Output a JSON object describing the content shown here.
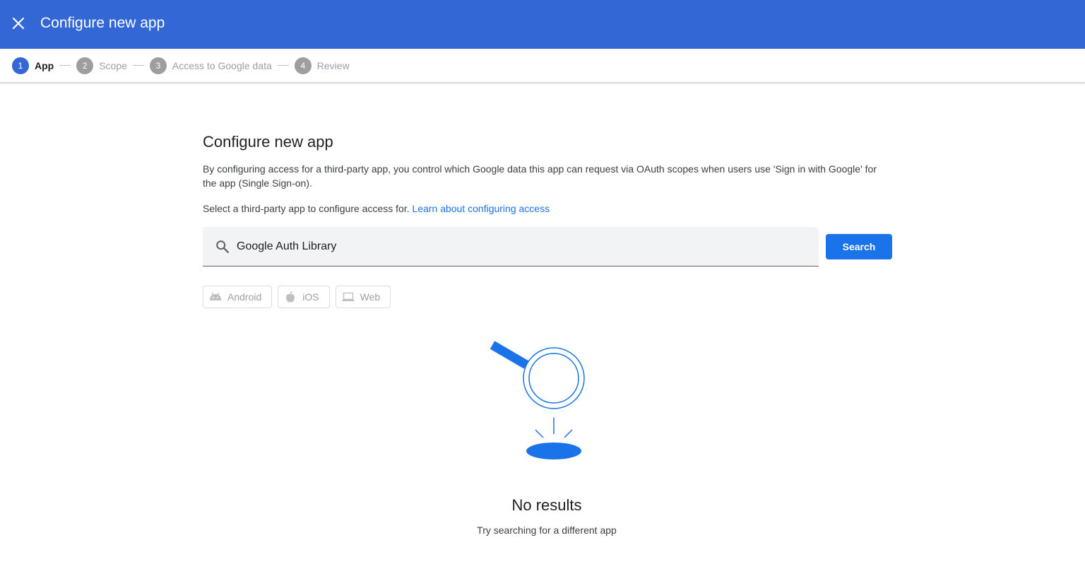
{
  "header": {
    "title": "Configure new app",
    "close_icon": "close-icon",
    "background_color": "#3367d6"
  },
  "stepper": {
    "steps": [
      {
        "number": "1",
        "label": "App",
        "active": true
      },
      {
        "number": "2",
        "label": "Scope",
        "active": false
      },
      {
        "number": "3",
        "label": "Access to Google data",
        "active": false
      },
      {
        "number": "4",
        "label": "Review",
        "active": false
      }
    ]
  },
  "main": {
    "title": "Configure new app",
    "description": "By configuring access for a third-party app, you control which Google data this app can request via OAuth scopes when users use 'Sign in with Google' for the app (Single Sign-on).",
    "select_prompt": "Select a third-party app to configure access for.",
    "learn_link": "Learn about configuring access"
  },
  "search": {
    "value": "Google Auth Library",
    "button_label": "Search",
    "icon": "search-icon"
  },
  "filters": [
    {
      "label": "Android",
      "icon": "android-icon"
    },
    {
      "label": "iOS",
      "icon": "apple-icon"
    },
    {
      "label": "Web",
      "icon": "laptop-icon"
    }
  ],
  "empty_state": {
    "title": "No results",
    "subtitle": "Try searching for a different app",
    "illustration": "magnifier-illustration",
    "accent_color": "#1a73e8"
  }
}
